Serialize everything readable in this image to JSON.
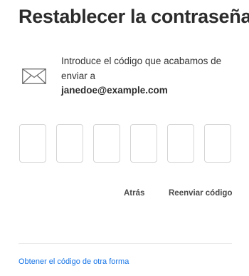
{
  "title": "Restablecer la contraseña",
  "message": {
    "line1": "Introduce el código que acabamos de",
    "line2": "enviar a",
    "email": "janedoe@example.com"
  },
  "code_inputs": [
    "",
    "",
    "",
    "",
    "",
    ""
  ],
  "actions": {
    "back_label": "Atrás",
    "resend_label": "Reenviar código"
  },
  "footer": {
    "alt_method_link": "Obtener el código de otra forma"
  },
  "icons": {
    "message_icon": "envelope-icon"
  },
  "colors": {
    "link": "#1473e6",
    "text": "#2c2c2c",
    "input_border": "#d5d5d5"
  }
}
